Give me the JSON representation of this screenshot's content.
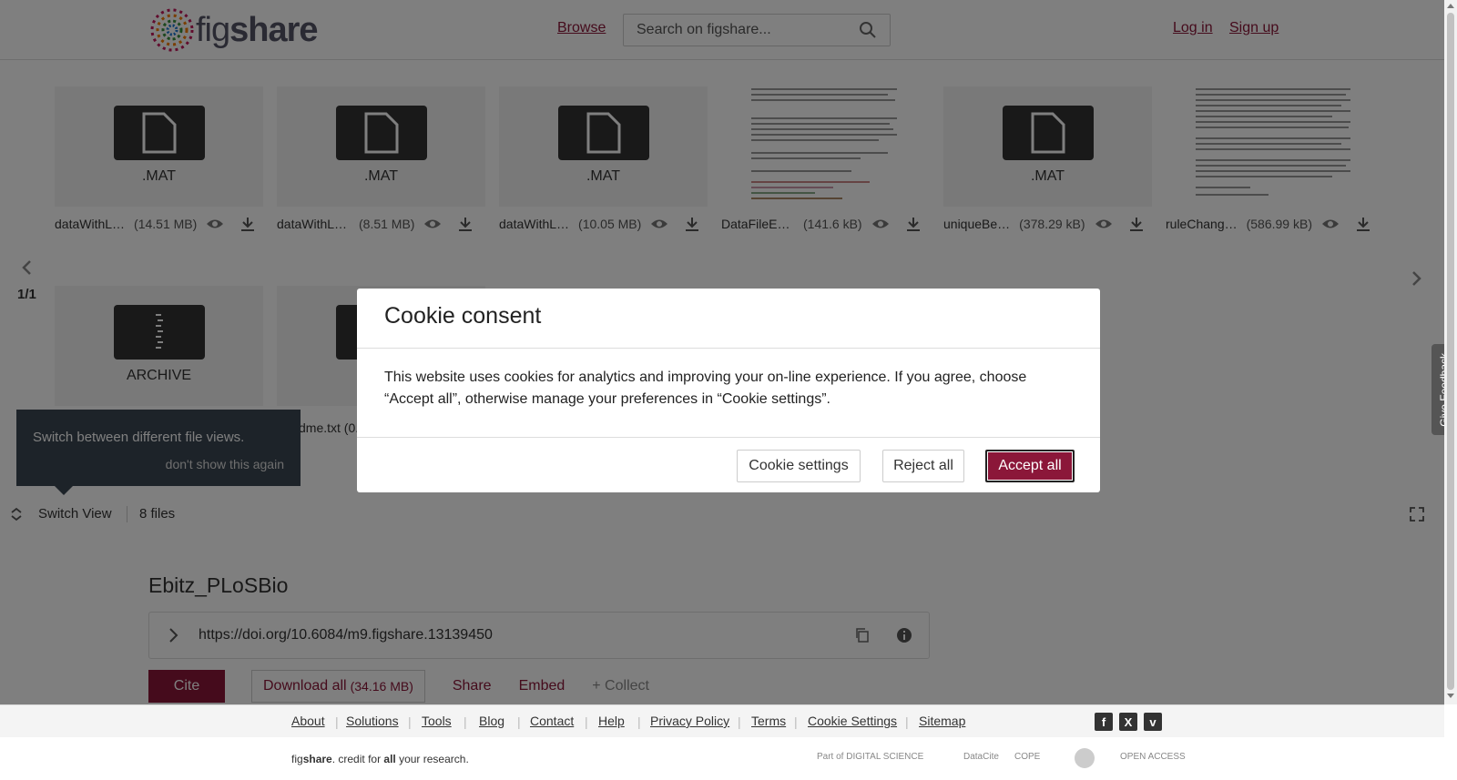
{
  "header": {
    "logo_text_a": "fig",
    "logo_text_b": "share",
    "browse": "Browse",
    "search_placeholder": "Search on figshare...",
    "login": "Log in",
    "signup": "Sign up"
  },
  "files": [
    {
      "name": "dataWithL…",
      "size": "(14.51 MB)",
      "ext": ".MAT"
    },
    {
      "name": "dataWithLa…",
      "size": "(8.51 MB)",
      "ext": ".MAT"
    },
    {
      "name": "dataWithL…",
      "size": "(10.05 MB)",
      "ext": ".MAT"
    },
    {
      "name": "DataFileEx…",
      "size": "(141.6 kB)",
      "ext": ""
    },
    {
      "name": "uniqueBe…",
      "size": "(378.29 kB)",
      "ext": ".MAT"
    },
    {
      "name": "ruleChang…",
      "size": "(586.99 kB)",
      "ext": ""
    }
  ],
  "second_row": {
    "archive_ext": "ARCHIVE",
    "partial_name": "dme.txt (0.",
    "pager": "1/1"
  },
  "tooltip": {
    "text": "Switch between different file views.",
    "dismiss": "don't show this again"
  },
  "switch_bar": {
    "label": "Switch View",
    "count": "8 files"
  },
  "item": {
    "title": "Ebitz_PLoSBio",
    "doi": "https://doi.org/10.6084/m9.figshare.13139450",
    "cite": "Cite",
    "download": "Download all",
    "download_size": "(34.16 MB)",
    "share": "Share",
    "embed": "Embed",
    "collect": "+ Collect"
  },
  "footer": {
    "links": [
      "About",
      "Solutions",
      "Tools",
      "Blog",
      "Contact",
      "Help",
      "Privacy Policy",
      "Terms",
      "Cookie Settings",
      "Sitemap"
    ],
    "tagline_a": "fig",
    "tagline_b": "share",
    "tagline_c": ". credit for ",
    "tagline_d": "all",
    "tagline_e": " your research.",
    "partners": [
      "Part of DIGITAL SCIENCE",
      "DataCite",
      "COPE",
      "",
      "OPEN ACCESS"
    ]
  },
  "feedback": "Give Feedback",
  "modal": {
    "title": "Cookie consent",
    "body": "This website uses cookies for analytics and improving your on-line experience. If you agree, choose “Accept all”, otherwise manage your preferences in “Cookie settings”.",
    "settings": "Cookie settings",
    "reject": "Reject all",
    "accept": "Accept all"
  },
  "colors": {
    "accent": "#8b1739",
    "overlay": "rgba(0,0,0,0.5)"
  }
}
